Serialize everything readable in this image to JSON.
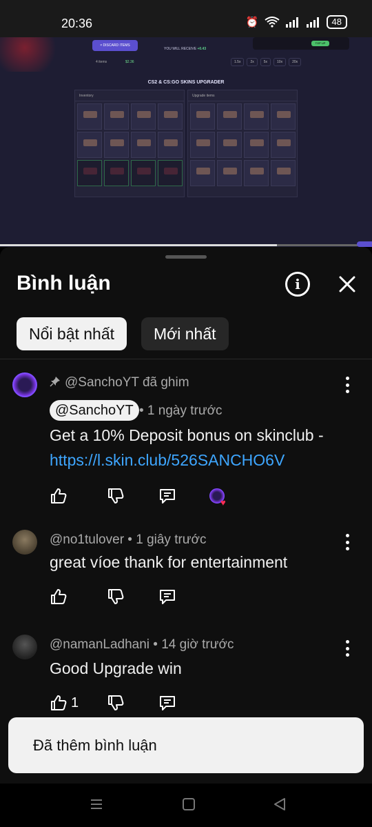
{
  "status_bar": {
    "time": "20:36",
    "battery": "48"
  },
  "video": {
    "discard_label": "× DISCARD ITEMS",
    "receive_label": "YOU WILL RECEIVE",
    "receive_value": "+0.43",
    "items_label": "4 items",
    "items_value": "$2.36",
    "multipliers": [
      "1.5x",
      "2x",
      "5x",
      "10x",
      "20x"
    ],
    "title": "CS2 & CS:GO SKINS UPGRADER",
    "inventory_label": "Inventory",
    "upgrade_label": "Upgrade items",
    "top_up": "TOP UP"
  },
  "sheet": {
    "title": "Bình luận",
    "tabs": [
      {
        "label": "Nổi bật nhất",
        "active": true
      },
      {
        "label": "Mới nhất",
        "active": false
      }
    ]
  },
  "comments": [
    {
      "pinned_by": "@SanchoYT đã ghim",
      "author": "@SanchoYT",
      "time": "• 1 ngày trước",
      "text": "Get a 10% Deposit bonus on skinclub -",
      "link": "https://l.skin.club/526SANCHO6V",
      "likes": ""
    },
    {
      "author_line": "@no1tulover • 1 giây trước",
      "text": "great víoe thank for entertainment",
      "likes": ""
    },
    {
      "author_line": "@namanLadhani • 14 giờ trước",
      "text": "Good Upgrade win",
      "likes": "1"
    }
  ],
  "toast": {
    "text": "Đã thêm bình luận"
  },
  "colors": {
    "link": "#3ea6ff",
    "background": "#0f0f0f",
    "chip_active": "#f1f1f1",
    "chip_inactive": "#272727"
  }
}
